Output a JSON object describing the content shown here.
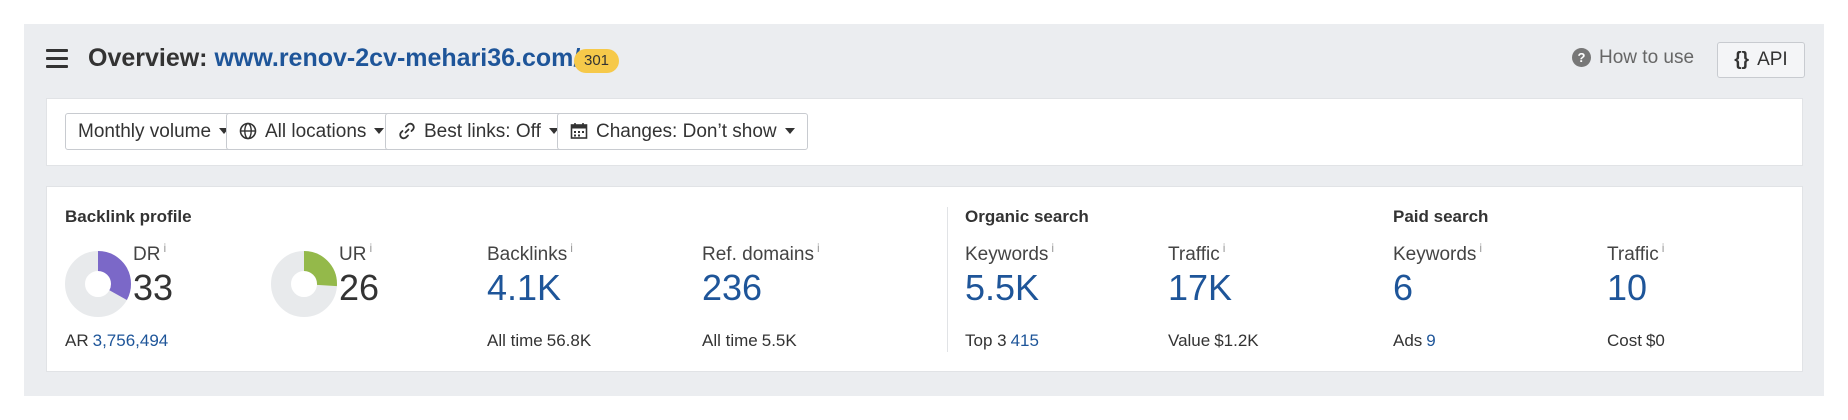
{
  "header": {
    "title_prefix": "Overview:",
    "url": "www.renov-2cv-mehari36.com/",
    "status_badge": "301",
    "how_to_use": "How to use",
    "help_glyph": "?",
    "api_braces": "{}",
    "api_label": "API"
  },
  "filters": {
    "monthly_volume": "Monthly volume",
    "locations": "All locations",
    "best_links": "Best links: Off",
    "changes": "Changes: Don’t show"
  },
  "backlink_profile": {
    "title": "Backlink profile",
    "dr": {
      "label": "DR",
      "value": "33",
      "fraction": 0.33
    },
    "ar": {
      "label": "AR",
      "value": "3,756,494"
    },
    "ur": {
      "label": "UR",
      "value": "26",
      "fraction": 0.26
    },
    "backlinks": {
      "label": "Backlinks",
      "value": "4.1K",
      "sub_label": "All time",
      "sub_value": "56.8K"
    },
    "ref_domains": {
      "label": "Ref. domains",
      "value": "236",
      "sub_label": "All time",
      "sub_value": "5.5K"
    }
  },
  "organic_search": {
    "title": "Organic search",
    "keywords": {
      "label": "Keywords",
      "value": "5.5K",
      "sub_label": "Top 3",
      "sub_value": "415"
    },
    "traffic": {
      "label": "Traffic",
      "value": "17K",
      "sub_label": "Value",
      "sub_value": "$1.2K"
    }
  },
  "paid_search": {
    "title": "Paid search",
    "keywords": {
      "label": "Keywords",
      "value": "6",
      "sub_label": "Ads",
      "sub_value": "9"
    },
    "traffic": {
      "label": "Traffic",
      "value": "10",
      "sub_label": "Cost",
      "sub_value": "$0"
    }
  },
  "info_glyph": "i",
  "colors": {
    "link": "#1e5599",
    "dr_donut": "#7b68c8",
    "ur_donut": "#94b94a",
    "donut_track": "#e8eaec",
    "badge": "#f6c94a"
  }
}
